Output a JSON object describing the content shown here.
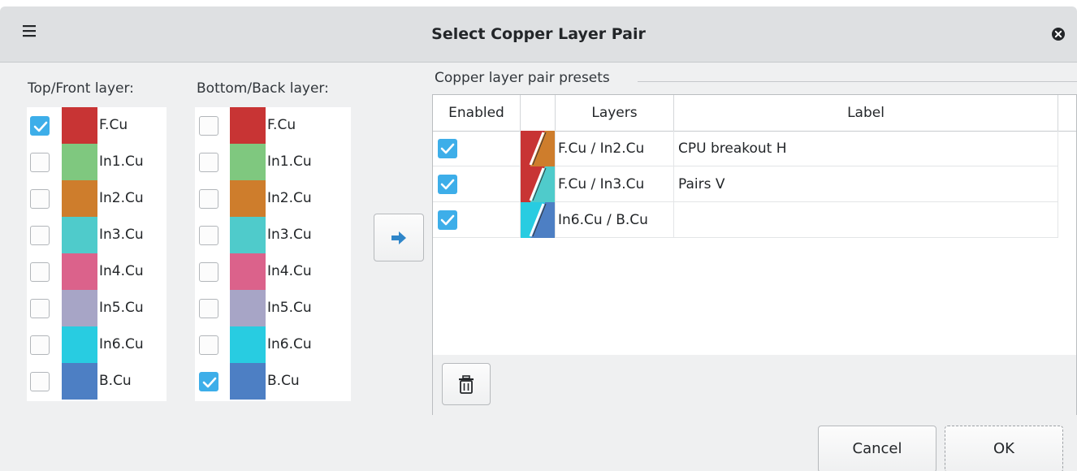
{
  "window": {
    "title": "Select Copper Layer Pair"
  },
  "top_layers": {
    "label": "Top/Front layer:",
    "items": [
      {
        "name": "F.Cu",
        "color": "#c83434",
        "checked": true
      },
      {
        "name": "In1.Cu",
        "color": "#7fc87f",
        "checked": false
      },
      {
        "name": "In2.Cu",
        "color": "#ce7d2c",
        "checked": false
      },
      {
        "name": "In3.Cu",
        "color": "#4fcbcb",
        "checked": false
      },
      {
        "name": "In4.Cu",
        "color": "#db628b",
        "checked": false
      },
      {
        "name": "In5.Cu",
        "color": "#a7a5c6",
        "checked": false
      },
      {
        "name": "In6.Cu",
        "color": "#28cce1",
        "checked": false
      },
      {
        "name": "B.Cu",
        "color": "#4d7fc4",
        "checked": false
      }
    ]
  },
  "bottom_layers": {
    "label": "Bottom/Back layer:",
    "items": [
      {
        "name": "F.Cu",
        "color": "#c83434",
        "checked": false
      },
      {
        "name": "In1.Cu",
        "color": "#7fc87f",
        "checked": false
      },
      {
        "name": "In2.Cu",
        "color": "#ce7d2c",
        "checked": false
      },
      {
        "name": "In3.Cu",
        "color": "#4fcbcb",
        "checked": false
      },
      {
        "name": "In4.Cu",
        "color": "#db628b",
        "checked": false
      },
      {
        "name": "In5.Cu",
        "color": "#a7a5c6",
        "checked": false
      },
      {
        "name": "In6.Cu",
        "color": "#28cce1",
        "checked": false
      },
      {
        "name": "B.Cu",
        "color": "#4d7fc4",
        "checked": true
      }
    ]
  },
  "presets": {
    "group_title": "Copper layer pair presets",
    "columns": {
      "enabled": "Enabled",
      "swatch": "",
      "layers": "Layers",
      "label": "Label"
    },
    "rows": [
      {
        "enabled": true,
        "layers": "F.Cu / In2.Cu",
        "label": "CPU breakout H",
        "color_a": "#c83434",
        "color_b": "#ce7d2c"
      },
      {
        "enabled": true,
        "layers": "F.Cu / In3.Cu",
        "label": "Pairs V",
        "color_a": "#c83434",
        "color_b": "#4fcbcb"
      },
      {
        "enabled": true,
        "layers": "In6.Cu / B.Cu",
        "label": "",
        "color_a": "#28cce1",
        "color_b": "#4d7fc4"
      }
    ]
  },
  "buttons": {
    "cancel": "Cancel",
    "ok": "OK"
  },
  "icons": {
    "menu": "hamburger-icon",
    "close": "close-icon",
    "add": "arrow-right-icon",
    "delete": "trash-icon"
  },
  "accent": "#3daee9"
}
